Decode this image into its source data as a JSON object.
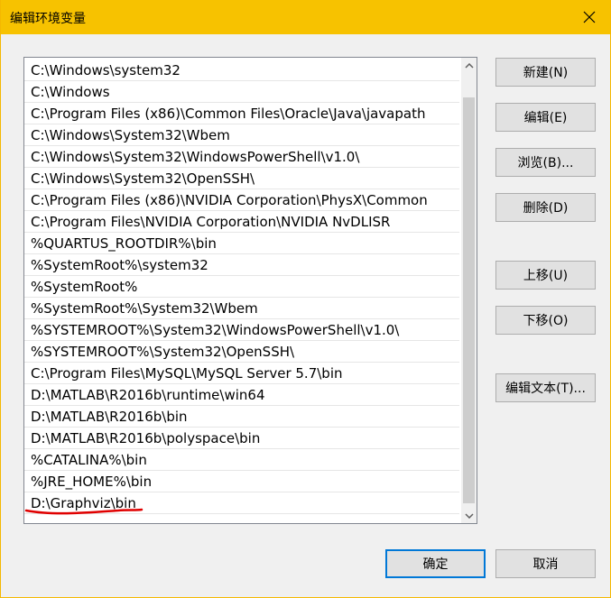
{
  "window": {
    "title": "编辑环境变量"
  },
  "list": {
    "items": [
      "C:\\Windows\\system32",
      "C:\\Windows",
      "C:\\Program Files (x86)\\Common Files\\Oracle\\Java\\javapath",
      "C:\\Windows\\System32\\Wbem",
      "C:\\Windows\\System32\\WindowsPowerShell\\v1.0\\",
      "C:\\Windows\\System32\\OpenSSH\\",
      "C:\\Program Files (x86)\\NVIDIA Corporation\\PhysX\\Common",
      "C:\\Program Files\\NVIDIA Corporation\\NVIDIA NvDLISR",
      "%QUARTUS_ROOTDIR%\\bin",
      "%SystemRoot%\\system32",
      "%SystemRoot%",
      "%SystemRoot%\\System32\\Wbem",
      "%SYSTEMROOT%\\System32\\WindowsPowerShell\\v1.0\\",
      "%SYSTEMROOT%\\System32\\OpenSSH\\",
      "C:\\Program Files\\MySQL\\MySQL Server 5.7\\bin",
      "D:\\MATLAB\\R2016b\\runtime\\win64",
      "D:\\MATLAB\\R2016b\\bin",
      "D:\\MATLAB\\R2016b\\polyspace\\bin",
      "%CATALINA%\\bin",
      "%JRE_HOME%\\bin",
      "D:\\Graphviz\\bin"
    ]
  },
  "buttons": {
    "new": "新建(N)",
    "edit": "编辑(E)",
    "browse": "浏览(B)...",
    "delete": "删除(D)",
    "move_up": "上移(U)",
    "move_down": "下移(O)",
    "edit_text": "编辑文本(T)...",
    "ok": "确定",
    "cancel": "取消"
  },
  "colors": {
    "titlebar": "#f7c200",
    "annotation": "#e00000",
    "default_button_border": "#0078d7"
  }
}
